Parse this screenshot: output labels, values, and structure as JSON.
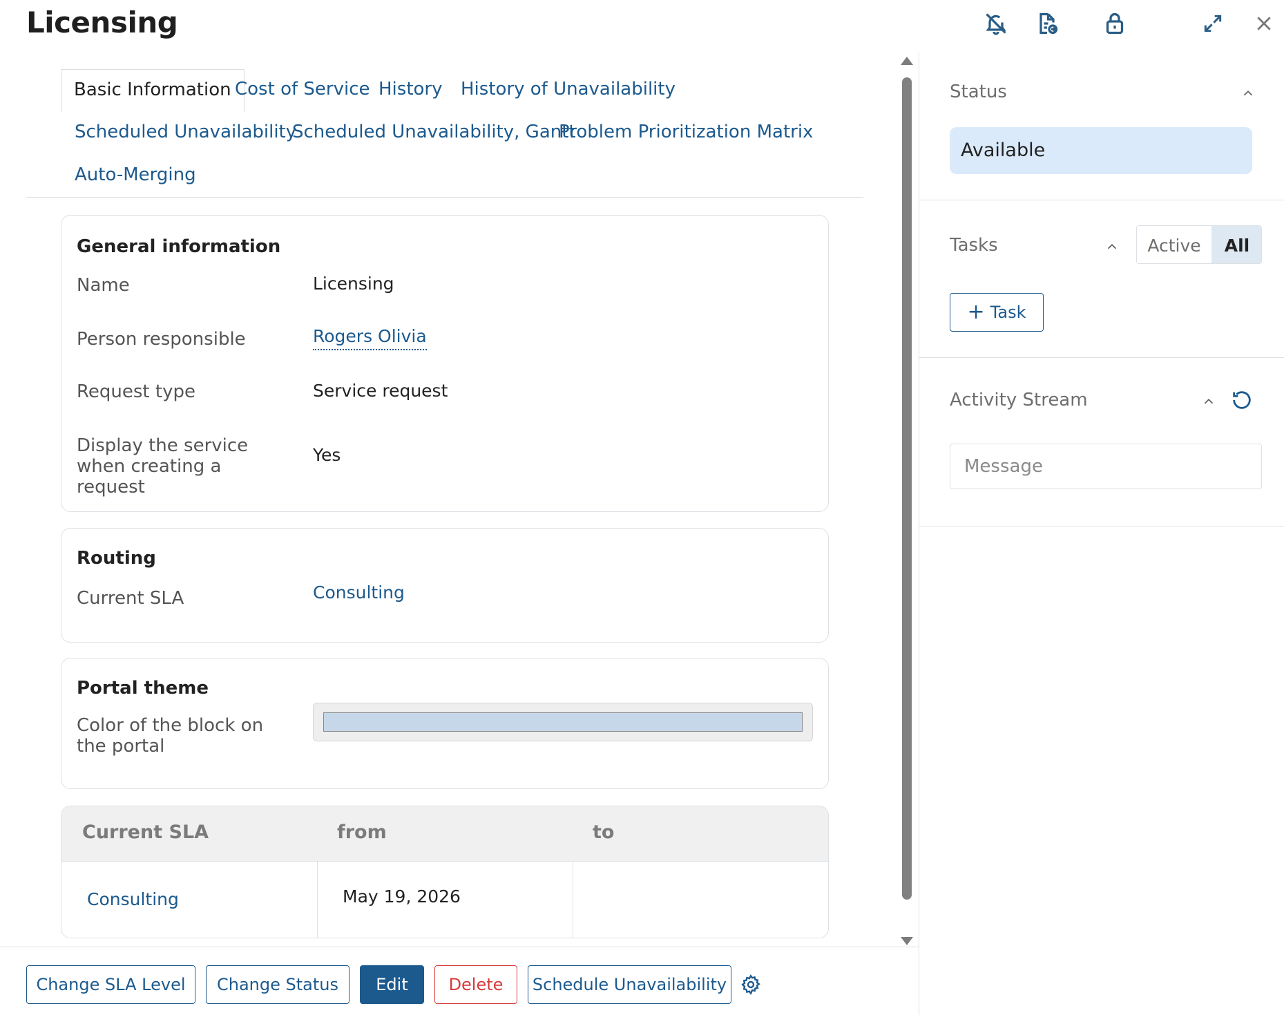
{
  "window": {
    "title": "Licensing",
    "icons": [
      "bell-off-icon",
      "document-export-icon",
      "lock-icon",
      "expand-icon",
      "close-icon"
    ]
  },
  "tabs": [
    {
      "label": "Basic Information",
      "active": true
    },
    {
      "label": "Cost of Service",
      "active": false
    },
    {
      "label": "History",
      "active": false
    },
    {
      "label": "History of Unavailability",
      "active": false
    },
    {
      "label": "Scheduled Unavailability",
      "active": false
    },
    {
      "label": "Scheduled Unavailability, Gantt",
      "active": false
    },
    {
      "label": "Problem Prioritization Matrix",
      "active": false
    },
    {
      "label": "Auto-Merging",
      "active": false
    }
  ],
  "general": {
    "title": "General information",
    "name_label": "Name",
    "name_value": "Licensing",
    "person_label": "Person responsible",
    "person_value": "Rogers Olivia",
    "request_type_label": "Request type",
    "request_type_value": "Service request",
    "display_label": "Display the service when creating a request",
    "display_value": "Yes"
  },
  "routing": {
    "title": "Routing",
    "sla_label": "Current SLA",
    "sla_value": "Consulting"
  },
  "portal_theme": {
    "title": "Portal theme",
    "color_label": "Color of the block on the portal",
    "color_value": "#c5d7e8"
  },
  "sla_table": {
    "headers": [
      "Current SLA",
      "from",
      "to"
    ],
    "rows": [
      {
        "sla": "Consulting",
        "from": "May 19, 2026",
        "to": ""
      }
    ]
  },
  "actions": {
    "change_sla": "Change SLA Level",
    "change_status": "Change Status",
    "edit": "Edit",
    "delete": "Delete",
    "schedule": "Schedule Unavailability"
  },
  "sidebar": {
    "status": {
      "label": "Status",
      "value": "Available"
    },
    "tasks": {
      "label": "Tasks",
      "filter_active": "Active",
      "filter_all": "All",
      "selected_filter": "All",
      "add_label": "Task"
    },
    "activity": {
      "label": "Activity Stream",
      "message_placeholder": "Message"
    }
  },
  "colors": {
    "accent": "#1c5a8e",
    "danger": "#d63b3b",
    "status_bg": "#dbeafa"
  }
}
